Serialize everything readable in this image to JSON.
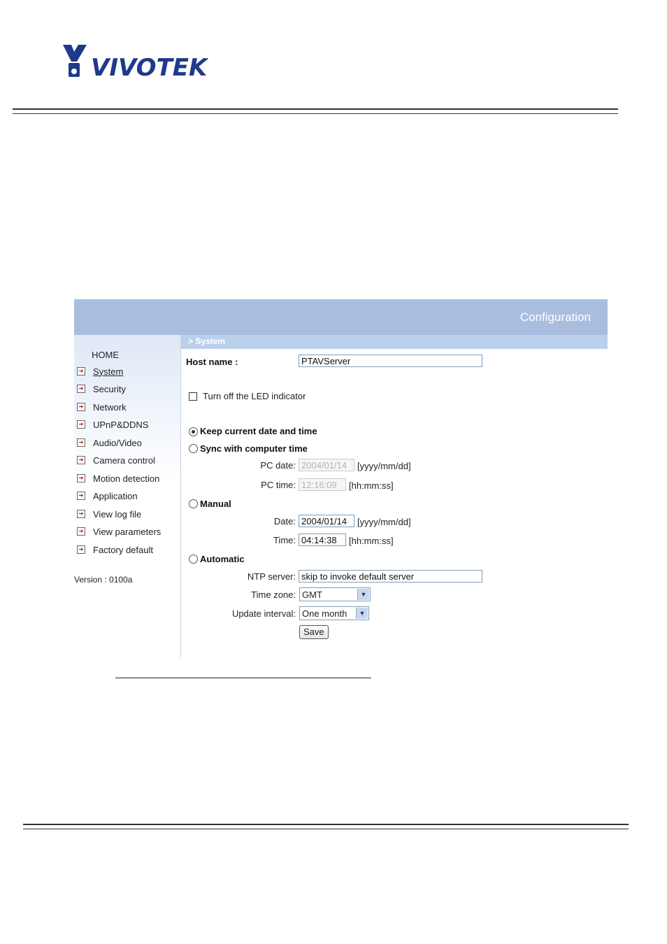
{
  "brand": {
    "name": "VIVOTEK"
  },
  "header": {
    "title": "Configuration"
  },
  "breadcrumb": "> System",
  "sidebar": {
    "home": "HOME",
    "items": [
      {
        "label": "System"
      },
      {
        "label": "Security"
      },
      {
        "label": "Network"
      },
      {
        "label": "UPnP&DDNS"
      },
      {
        "label": "Audio/Video"
      },
      {
        "label": "Camera control"
      },
      {
        "label": "Motion detection"
      },
      {
        "label": "Application"
      },
      {
        "label": "View log file"
      },
      {
        "label": "View parameters"
      },
      {
        "label": "Factory default"
      }
    ],
    "version": "Version : 0100a"
  },
  "form": {
    "host_name_label": "Host name :",
    "host_name_value": "PTAVServer",
    "led_label": "Turn off the LED indicator",
    "keep_label": "Keep current date and time",
    "sync_label": "Sync with computer time",
    "pc_date_label": "PC date:",
    "pc_date_value": "2004/01/14",
    "date_format": "[yyyy/mm/dd]",
    "pc_time_label": "PC time:",
    "pc_time_value": "12:16:09",
    "time_format": "[hh:mm:ss]",
    "manual_label": "Manual",
    "date_label": "Date:",
    "date_value": "2004/01/14",
    "time_label": "Time:",
    "time_value": "04:14:38",
    "automatic_label": "Automatic",
    "ntp_label": "NTP server:",
    "ntp_value": "skip to invoke default server",
    "timezone_label": "Time zone:",
    "timezone_value": "GMT",
    "interval_label": "Update interval:",
    "interval_value": "One month",
    "save_label": "Save"
  }
}
